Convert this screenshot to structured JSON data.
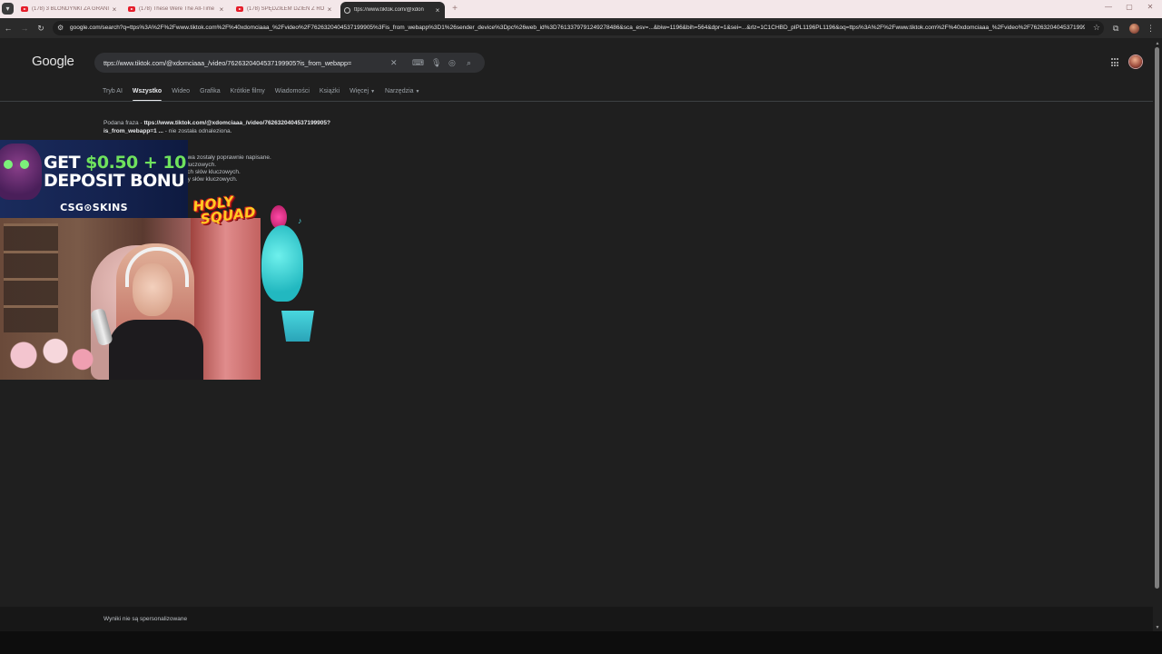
{
  "browser": {
    "tabs": [
      {
        "title": "(178) 3 BLONDYNKI ZA GRANI",
        "icon": "youtube-icon",
        "active": false
      },
      {
        "title": "(178) These Were The All-Time",
        "icon": "youtube-icon",
        "active": false
      },
      {
        "title": "(178) SPĘDZIŁEM DZIEŃ Z RO",
        "icon": "youtube-icon",
        "active": false
      },
      {
        "title": "ttps://www.tiktok.com/@xdon",
        "icon": "globe-icon",
        "active": true
      }
    ],
    "address": "google.com/search?q=ttps%3A%2F%2Fwww.tiktok.com%2F%40xdomciaaa_%2Fvideo%2F7626320404537199905%3Fis_from_webapp%3D1%26sender_device%3Dpc%26web_id%3D7613379791249278486&sca_esv=...&biw=1196&bih=564&dpr=1&sei=...&rlz=1C1CHBD_plPL1196PL1196&oq=ttps%3A%2F%2Fwww.tiktok.com%2F%40xdomciaaa_%2Fvideo%2F7626320404537199905%3Fis_from_webapp%3D1%26..."
  },
  "google": {
    "logo": "Google",
    "query": "ttps://www.tiktok.com/@xdomciaaa_/video/7626320404537199905?is_from_webapp=",
    "tabs": [
      {
        "label": "Tryb AI",
        "active": false
      },
      {
        "label": "Wszystko",
        "active": true
      },
      {
        "label": "Wideo",
        "active": false
      },
      {
        "label": "Grafika",
        "active": false
      },
      {
        "label": "Krótkie filmy",
        "active": false
      },
      {
        "label": "Wiadomości",
        "active": false
      },
      {
        "label": "Książki",
        "active": false
      },
      {
        "label": "Więcej",
        "active": false,
        "dropdown": true
      },
      {
        "label": "Narzędzia",
        "active": false,
        "dropdown": true
      }
    ],
    "no_results": {
      "prefix": "Podana fraza - ",
      "phrase_line1": "ttps://www.tiktok.com/@xdomciaaa_/video/7626320404537199905?",
      "phrase_line2": "is_from_webapp=1 ...",
      "suffix": " - nie została odnaleziona."
    },
    "suggestions": [
      "owa zostały poprawnie napisane.",
      "kluczowych.",
      "ych słów kluczowych.",
      "by słów kluczowych."
    ],
    "footer": "Wyniki nie są spersonalizowane"
  },
  "overlay": {
    "ad_line1_white": "GET ",
    "ad_line1_green": "$0.50 + 10",
    "ad_line2": "DEPOSIT BONU",
    "ad_brand": "CSG⊙SKINS",
    "logo_line1": "HOLY",
    "logo_line2": "SQUAD"
  },
  "colors": {
    "page_bg": "#1f1f1f",
    "tabstrip_bg": "#f3e7e9",
    "ad_green": "#6fe25d"
  }
}
